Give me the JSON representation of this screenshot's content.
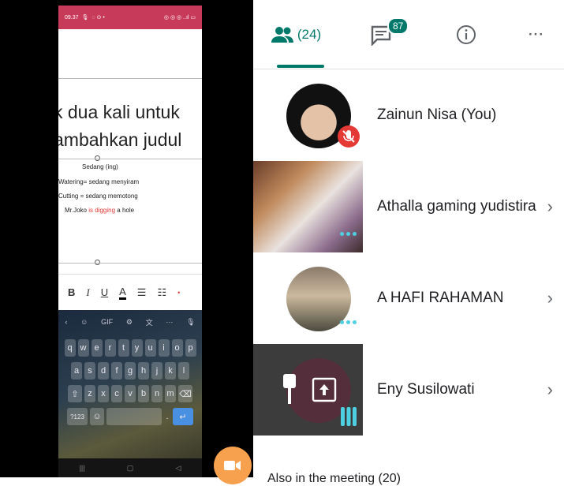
{
  "phone": {
    "status_time": "09.37",
    "doc": {
      "line1": "k dua kali untuk",
      "line2": "ambahkan judul",
      "subtitle": "Sedang (ing)",
      "item1": "Watering= sedang menyiram",
      "item2": "Cutting = sedang memotong",
      "item3_a": "Mr.Joko ",
      "item3_b": "is digging",
      "item3_c": " a hole"
    },
    "format_bar": [
      "B",
      "I",
      "U",
      "A"
    ],
    "keyboard": {
      "row1": [
        "q",
        "w",
        "e",
        "r",
        "t",
        "y",
        "u",
        "i",
        "o",
        "p"
      ],
      "row2": [
        "a",
        "s",
        "d",
        "f",
        "g",
        "h",
        "j",
        "k",
        "l"
      ],
      "row3": [
        "z",
        "x",
        "c",
        "v",
        "b",
        "n",
        "m"
      ],
      "symbols_key": "?123",
      "gif": "GIF"
    }
  },
  "meet": {
    "participants_count": "(24)",
    "chat_badge": "87",
    "participants": [
      {
        "name": "Zainun Nisa (You)"
      },
      {
        "name": "Athalla gaming yudistira"
      },
      {
        "name": "A HAFI RAHAMAN"
      },
      {
        "name": "Eny Susilowati"
      }
    ],
    "footer_label": "Also in the meeting (20)",
    "colors": {
      "accent": "#00796b",
      "mic_off": "#e53935",
      "fab": "#f7a14f",
      "dots": "#4dd0e1"
    }
  }
}
